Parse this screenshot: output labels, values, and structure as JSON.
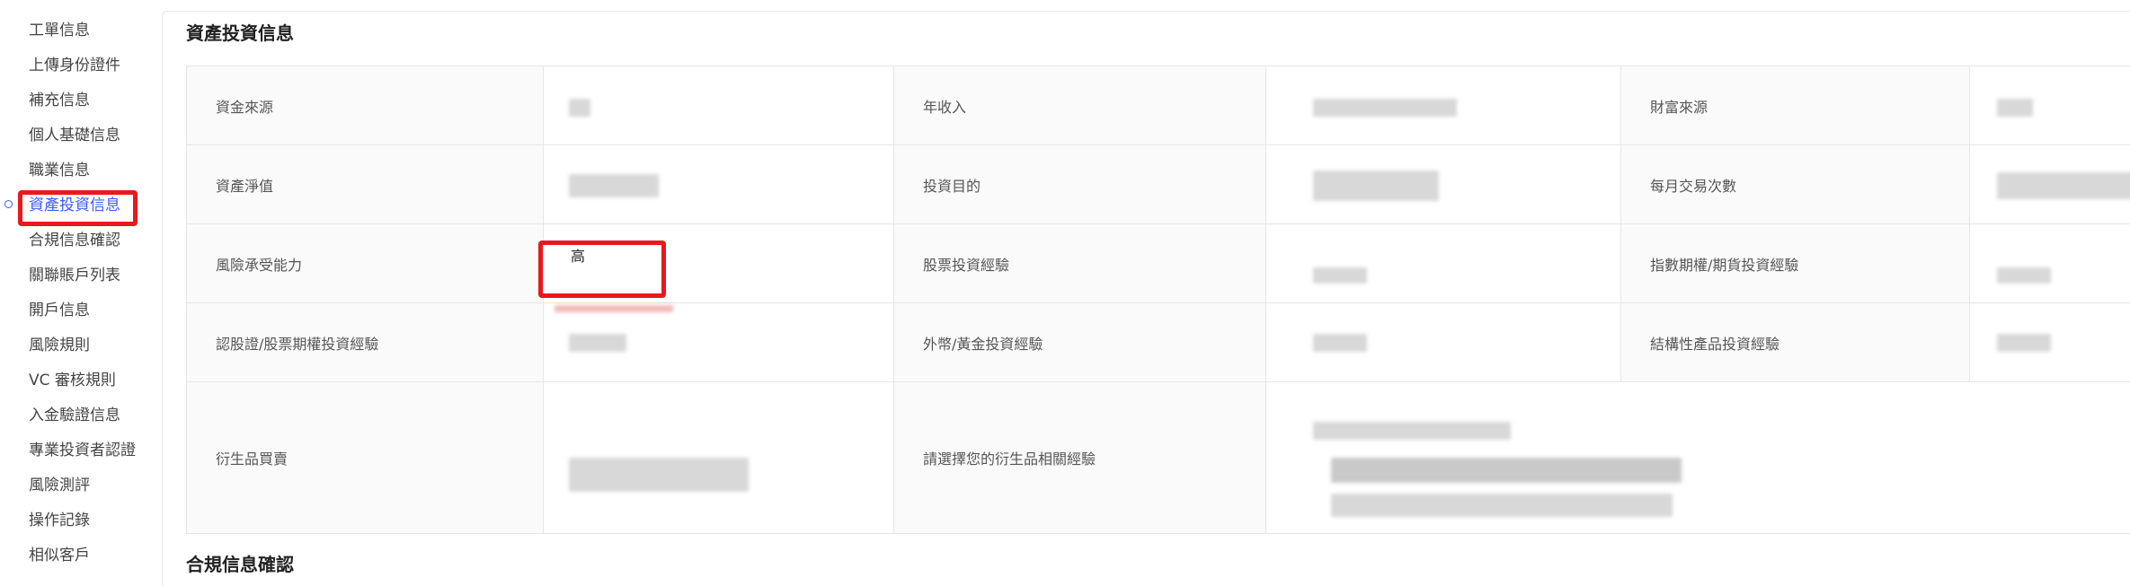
{
  "sidebar": {
    "items": [
      {
        "label": "工單信息"
      },
      {
        "label": "上傳身份證件"
      },
      {
        "label": "補充信息"
      },
      {
        "label": "個人基礎信息"
      },
      {
        "label": "職業信息"
      },
      {
        "label": "資產投資信息",
        "active": true
      },
      {
        "label": "合規信息確認"
      },
      {
        "label": "關聯賬戶列表"
      },
      {
        "label": "開戶信息"
      },
      {
        "label": "風險規則"
      },
      {
        "label": "VC 審核規則"
      },
      {
        "label": "入金驗證信息"
      },
      {
        "label": "專業投資者認證"
      },
      {
        "label": "風險測評"
      },
      {
        "label": "操作記錄"
      },
      {
        "label": "相似客戶"
      }
    ]
  },
  "section": {
    "title": "資產投資信息",
    "next_title": "合規信息確認"
  },
  "rows": [
    [
      {
        "label": "資金來源"
      },
      {
        "label": "年收入"
      },
      {
        "label": "財富來源"
      }
    ],
    [
      {
        "label": "資產淨值"
      },
      {
        "label": "投資目的"
      },
      {
        "label": "每月交易次數"
      }
    ],
    [
      {
        "label": "風險承受能力",
        "value": "高"
      },
      {
        "label": "股票投資經驗"
      },
      {
        "label": "指數期權/期貨投資經驗"
      }
    ],
    [
      {
        "label": "認股證/股票期權投資經驗"
      },
      {
        "label": "外幣/黃金投資經驗"
      },
      {
        "label": "結構性產品投資經驗"
      }
    ],
    [
      {
        "label": "衍生品買賣"
      },
      {
        "label": "請選擇您的衍生品相關經驗"
      }
    ]
  ],
  "colors": {
    "highlight": "#e8191c",
    "active": "#3d5afe"
  }
}
